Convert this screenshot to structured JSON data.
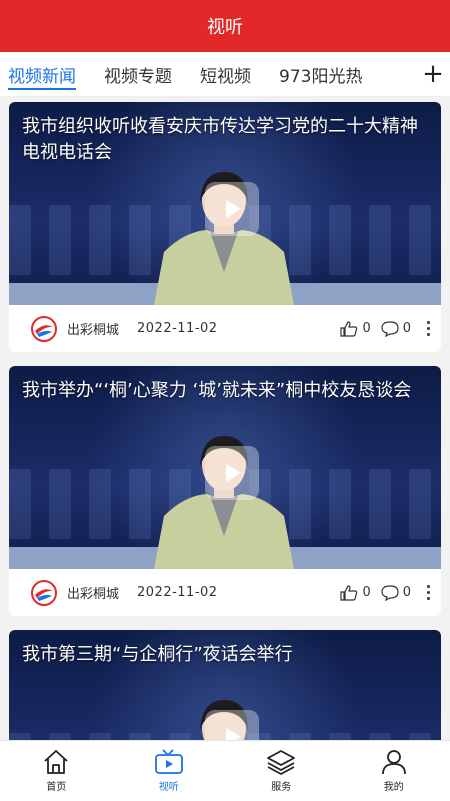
{
  "header": {
    "title": "视听"
  },
  "tabs": [
    {
      "label": "视频新闻",
      "active": true
    },
    {
      "label": "视频专题",
      "active": false
    },
    {
      "label": "短视频",
      "active": false
    },
    {
      "label": "973阳光热",
      "active": false
    }
  ],
  "tabs_add_label": "+",
  "feed": {
    "items": [
      {
        "title": "我市组织收听收看安庆市传达学习党的二十大精神电视电话会",
        "source": "出彩桐城",
        "date": "2022-11-02",
        "likes": "0",
        "comments": "0"
      },
      {
        "title": "我市举办“‘桐’心聚力 ‘城’就未来”桐中校友恳谈会",
        "source": "出彩桐城",
        "date": "2022-11-02",
        "likes": "0",
        "comments": "0"
      },
      {
        "title": "我市第三期“与企桐行”夜话会举行"
      }
    ]
  },
  "bottom_nav": [
    {
      "label": "首页",
      "icon": "home-icon"
    },
    {
      "label": "视听",
      "icon": "video-icon",
      "active": true
    },
    {
      "label": "服务",
      "icon": "layers-icon"
    },
    {
      "label": "我的",
      "icon": "user-icon"
    }
  ],
  "colors": {
    "header_bg": "#e22828",
    "accent": "#1a73e8"
  }
}
